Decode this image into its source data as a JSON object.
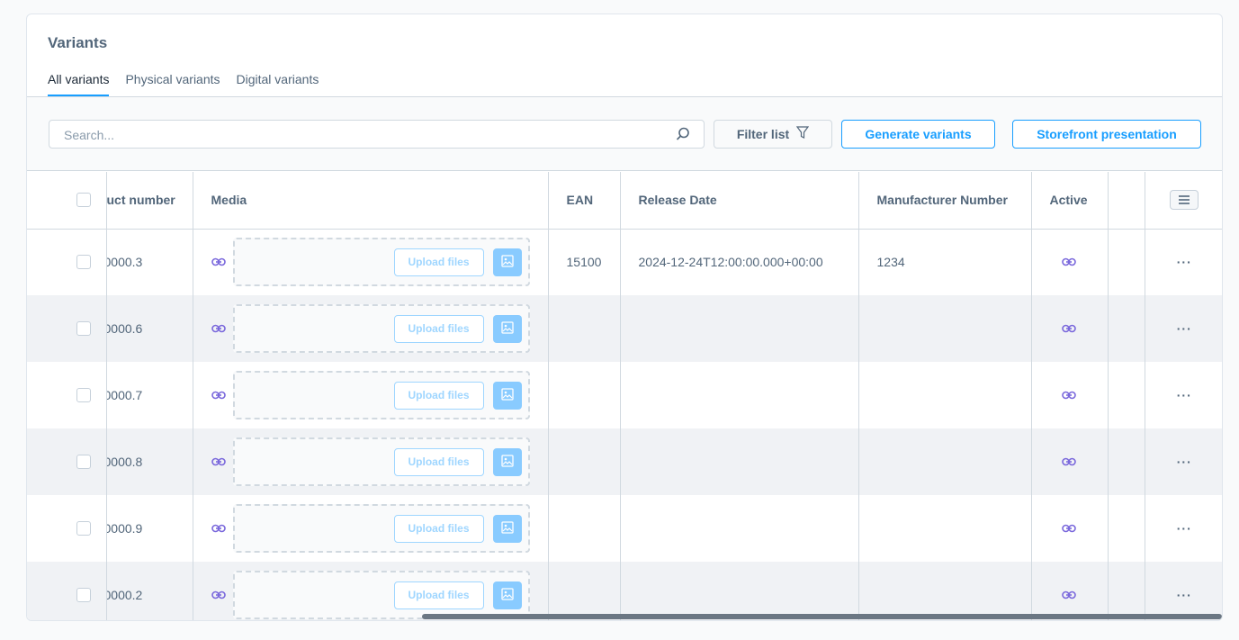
{
  "title": "Variants",
  "tabs": [
    {
      "label": "All variants",
      "active": true
    },
    {
      "label": "Physical variants"
    },
    {
      "label": "Digital variants"
    }
  ],
  "toolbar": {
    "search_placeholder": "Search...",
    "filter": "Filter list",
    "generate": "Generate variants",
    "storefront": "Storefront presentation"
  },
  "columns": [
    "uct number",
    "Media",
    "EAN",
    "Release Date",
    "Manufacturer Number",
    "Active",
    "",
    ""
  ],
  "upload_label": "Upload files",
  "colors": {
    "accent": "#189eff",
    "link_icon": "#7a68dc"
  },
  "rows": [
    {
      "product_number": "0000.3",
      "ean": "15100",
      "release_date": "2024-12-24T12:00:00.000+00:00",
      "manufacturer_number": "1234"
    },
    {
      "product_number": "0000.6",
      "ean": "",
      "release_date": "",
      "manufacturer_number": ""
    },
    {
      "product_number": "0000.7",
      "ean": "",
      "release_date": "",
      "manufacturer_number": ""
    },
    {
      "product_number": "0000.8",
      "ean": "",
      "release_date": "",
      "manufacturer_number": ""
    },
    {
      "product_number": "0000.9",
      "ean": "",
      "release_date": "",
      "manufacturer_number": ""
    },
    {
      "product_number": "0000.2",
      "ean": "",
      "release_date": "",
      "manufacturer_number": ""
    }
  ]
}
